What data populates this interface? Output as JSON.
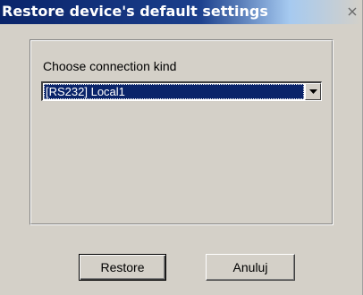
{
  "window": {
    "title": "Restore device's default settings",
    "close_icon": "close-x"
  },
  "connection": {
    "label": "Choose connection kind",
    "selected_value": "[RS232] Local1",
    "dropdown_icon": "chevron-down"
  },
  "buttons": {
    "restore_label": "Restore",
    "cancel_label": "Anuluj"
  },
  "colors": {
    "titlebar_start": "#0a246a",
    "titlebar_end": "#a6caf0",
    "selection": "#0a246a",
    "face": "#d4d0c8"
  }
}
